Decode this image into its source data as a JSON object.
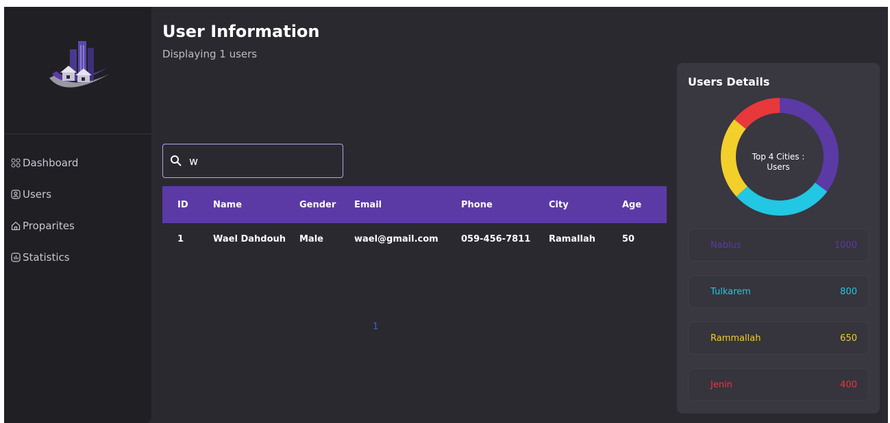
{
  "header": {
    "title": "User Information",
    "subtitle": "Displaying 1 users"
  },
  "sidebar": {
    "items": [
      {
        "label": "Dashboard",
        "icon": "dashboard-grid-icon"
      },
      {
        "label": "Users",
        "icon": "users-icon"
      },
      {
        "label": "Proparites",
        "icon": "home-icon"
      },
      {
        "label": "Statistics",
        "icon": "statistics-icon"
      }
    ]
  },
  "search": {
    "value": "w",
    "icon": "search-icon"
  },
  "table": {
    "columns": [
      "ID",
      "Name",
      "Gender",
      "Email",
      "Phone",
      "City",
      "Age"
    ],
    "rows": [
      [
        "1",
        "Wael Dahdouh",
        "Male",
        "wael@gmail.com",
        "059-456-7811",
        "Ramallah",
        "50"
      ]
    ]
  },
  "pagination": {
    "current": "1"
  },
  "details": {
    "title": "Users Details",
    "chart_label_line1": "Top 4 Cities :",
    "chart_label_line2": "Users",
    "cities": [
      {
        "name": "Nablus",
        "value": "1000",
        "color": "#5b3aa6"
      },
      {
        "name": "Tulkarem",
        "value": "800",
        "color": "#22c7e3"
      },
      {
        "name": "Rammallah",
        "value": "650",
        "color": "#f2cf2a"
      },
      {
        "name": "Jenin",
        "value": "400",
        "color": "#e8383b"
      }
    ]
  },
  "chart_data": {
    "type": "pie",
    "categories": [
      "Nablus",
      "Tulkarem",
      "Rammallah",
      "Jenin"
    ],
    "values": [
      1000,
      800,
      650,
      400
    ],
    "colors": [
      "#5b3aa6",
      "#22c7e3",
      "#f2cf2a",
      "#e8383b"
    ],
    "title": "Top 4 Cities : Users"
  },
  "colors": {
    "accent": "#5b3aa6",
    "background": "#2b2930",
    "sidebar": "#201f24",
    "card": "#393740"
  }
}
